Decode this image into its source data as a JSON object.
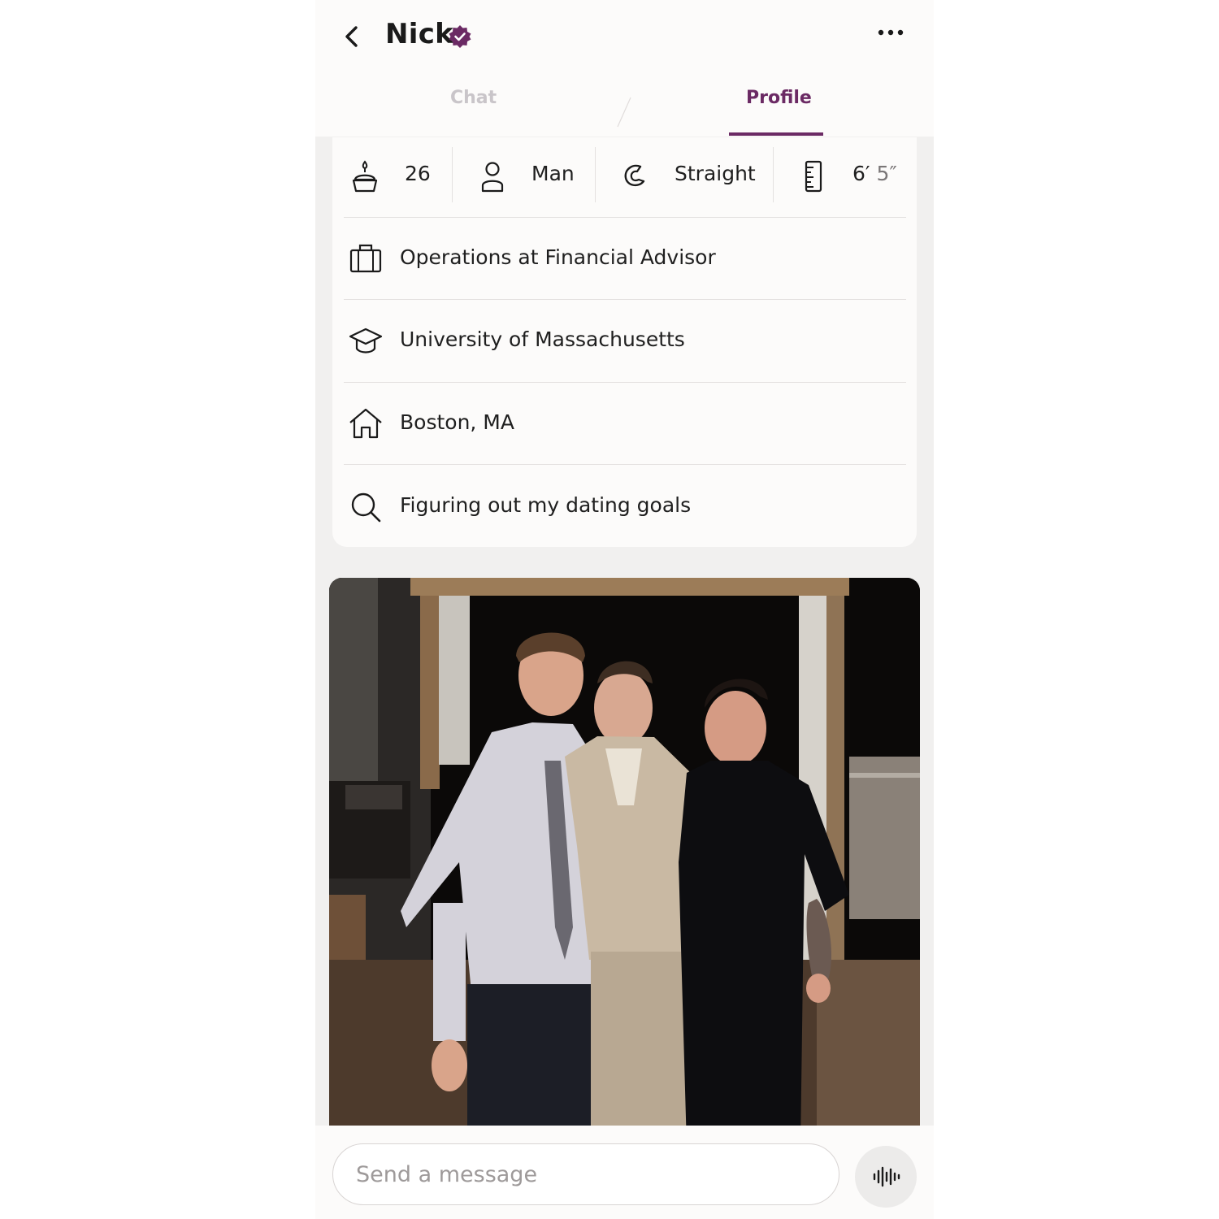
{
  "header": {
    "name": "Nick",
    "tabs": [
      {
        "label": "Chat",
        "active": false
      },
      {
        "label": "Profile",
        "active": true
      }
    ]
  },
  "stats": {
    "age": "26",
    "gender": "Man",
    "sexuality": "Straight",
    "height_feet": "6′",
    "height_inches": "5″"
  },
  "details": [
    {
      "icon": "briefcase-icon",
      "text": "Operations at Financial Advisor"
    },
    {
      "icon": "graduation-cap-icon",
      "text": "University of Massachusetts"
    },
    {
      "icon": "home-icon",
      "text": "Boston, MA"
    },
    {
      "icon": "search-icon",
      "text": "Figuring out my dating goals"
    }
  ],
  "composer": {
    "placeholder": "Send a message"
  },
  "colors": {
    "accent": "#6b2a64",
    "inactive_tab": "#c9c5c9",
    "background": "#f1f0ef",
    "card": "#fcfbfa"
  }
}
